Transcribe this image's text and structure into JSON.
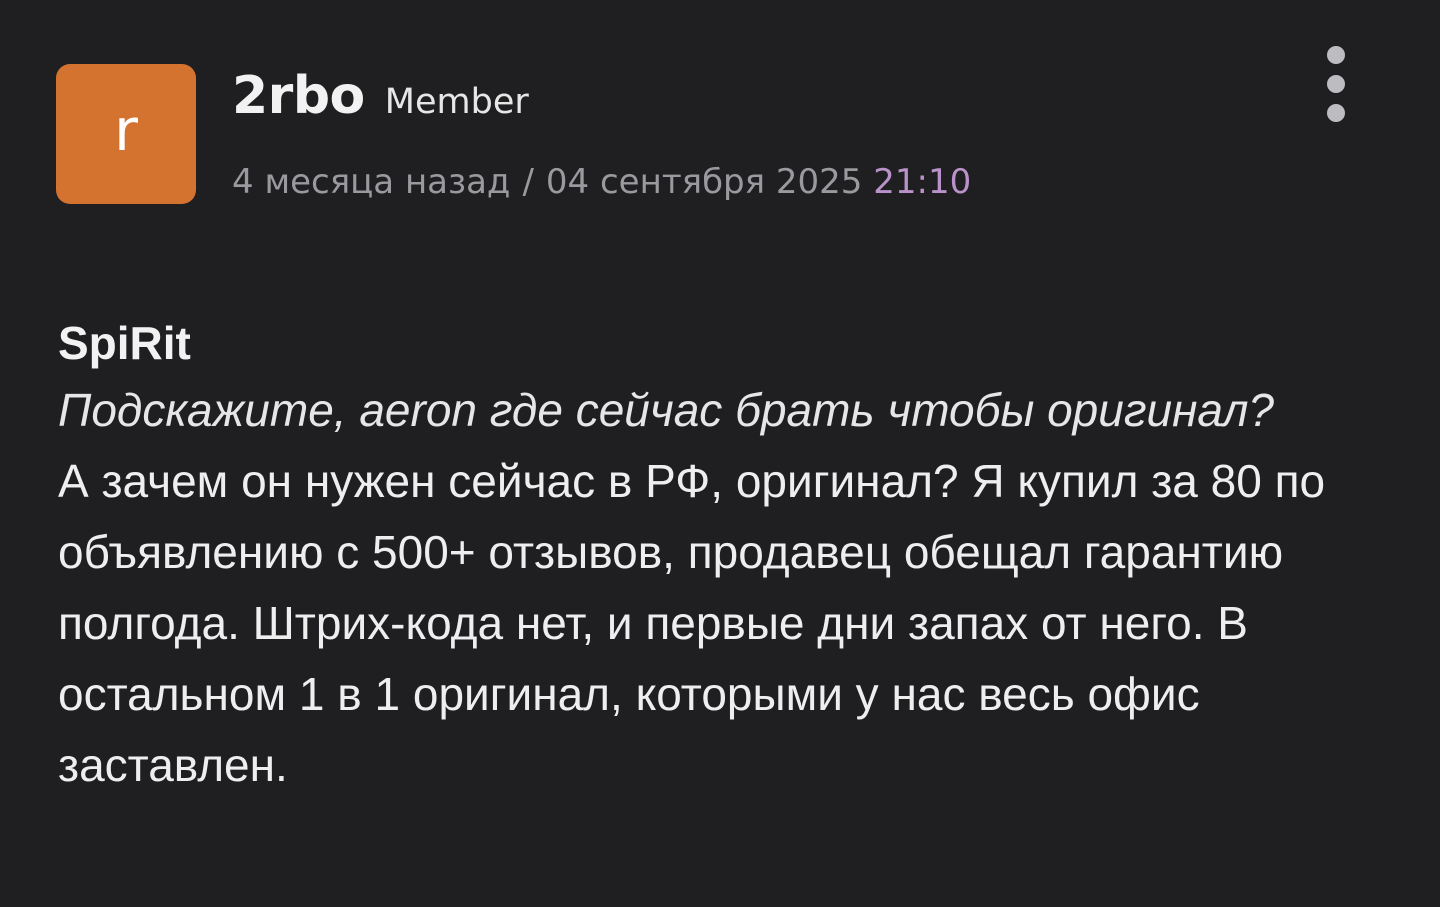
{
  "post": {
    "avatar_letter": "r",
    "avatar_color": "#d4722f",
    "username": "2rbo",
    "role": "Member",
    "relative_time": "4 месяца назад",
    "separator": "/",
    "date": "04 сентября 2025",
    "time": "21:10",
    "time_color": "#b892c9",
    "more_icon": "vertical-ellipsis-icon"
  },
  "quote": {
    "author": "SpiRit",
    "text": "Подскажите, aeron где сейчас брать чтобы оригинал?"
  },
  "reply": {
    "text": "А зачем он нужен сейчас в РФ, оригинал? Я купил за 80 по объявлению с 500+ отзывов, продавец обещал гарантию полгода. Штрих-кода нет, и первые дни запах от него. В остальном 1 в 1 оригинал, которыми у нас весь офис заставлен."
  }
}
